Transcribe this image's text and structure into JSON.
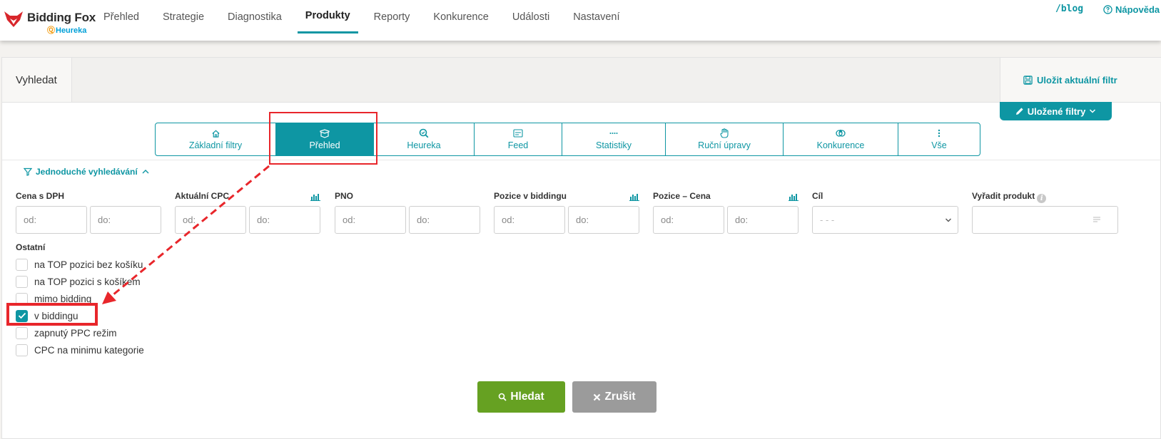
{
  "brand": {
    "name": "Bidding Fox",
    "sub": "Heureka"
  },
  "nav": {
    "items": [
      {
        "label": "Přehled"
      },
      {
        "label": "Strategie"
      },
      {
        "label": "Diagnostika"
      },
      {
        "label": "Produkty",
        "active": true
      },
      {
        "label": "Reporty"
      },
      {
        "label": "Konkurence"
      },
      {
        "label": "Události"
      },
      {
        "label": "Nastavení"
      }
    ],
    "blog": "/blog",
    "help": "Nápověda"
  },
  "search": {
    "label": "Vyhledat",
    "save_filter": "Uložit aktuální filtr",
    "saved_filters": "Uložené filtry"
  },
  "tabs": [
    {
      "label": "Základní filtry",
      "icon": "home-icon"
    },
    {
      "label": "Přehled",
      "icon": "box-icon",
      "active": true
    },
    {
      "label": "Heureka",
      "icon": "search-check-icon"
    },
    {
      "label": "Feed",
      "icon": "feed-icon"
    },
    {
      "label": "Statistiky",
      "icon": "dots-icon"
    },
    {
      "label": "Ruční úpravy",
      "icon": "hand-icon"
    },
    {
      "label": "Konkurence",
      "icon": "competition-icon"
    },
    {
      "label": "Vše",
      "icon": "vertical-dots-icon"
    }
  ],
  "simple_search": "Jednoduché vyhledávání",
  "fields": {
    "price": {
      "label": "Cena s DPH",
      "from": "od:",
      "to": "do:"
    },
    "cpc": {
      "label": "Aktuální CPC",
      "from": "od:",
      "to": "do:"
    },
    "pno": {
      "label": "PNO",
      "from": "od:",
      "to": "do:"
    },
    "position": {
      "label": "Pozice v biddingu",
      "from": "od:",
      "to": "do:"
    },
    "position_price": {
      "label": "Pozice – Cena",
      "from": "od:",
      "to": "do:"
    },
    "goal": {
      "label": "Cíl",
      "value": "- - -"
    },
    "exclude": {
      "label": "Vyřadit produkt"
    }
  },
  "other": {
    "title": "Ostatní",
    "options": [
      {
        "label": "na TOP pozici bez košíku",
        "checked": false
      },
      {
        "label": "na TOP pozici s košíkem",
        "checked": false
      },
      {
        "label": "mimo bidding",
        "checked": false
      },
      {
        "label": "v biddingu",
        "checked": true
      },
      {
        "label": "zapnutý PPC režim",
        "checked": false
      },
      {
        "label": "CPC na minimu kategorie",
        "checked": false
      }
    ]
  },
  "actions": {
    "search": "Hledat",
    "cancel": "Zrušit"
  },
  "colors": {
    "accent": "#0e96a3",
    "search_button": "#66a122",
    "cancel_button": "#9b9b9b",
    "annotation": "#e8262b"
  }
}
